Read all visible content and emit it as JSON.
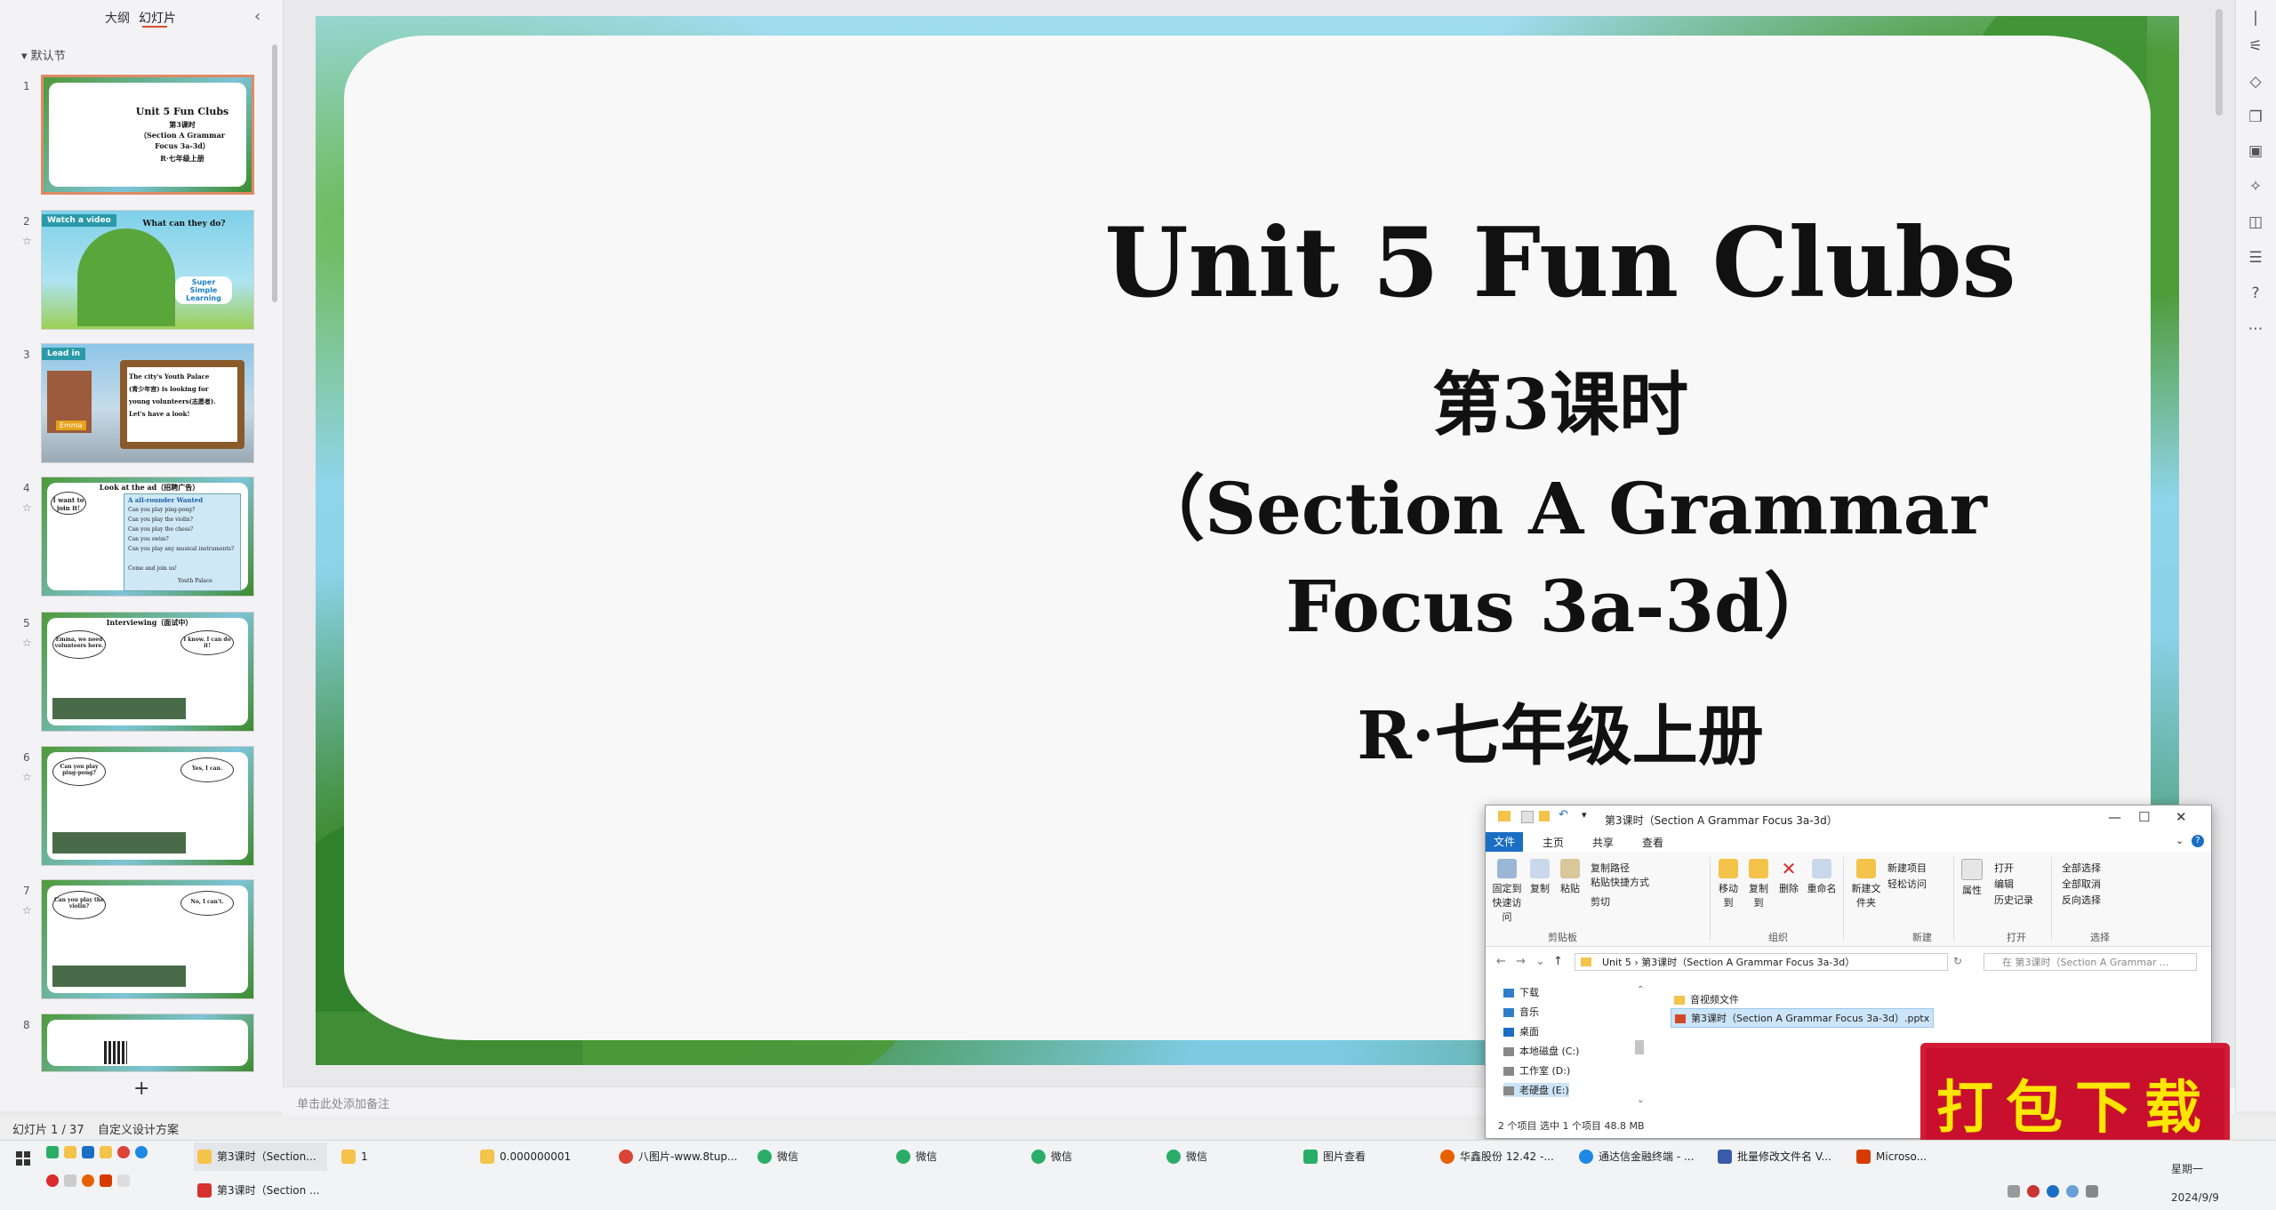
{
  "left_panel": {
    "tab_outline": "大纲",
    "tab_slides": "幻灯片",
    "collapse": "‹",
    "section_label": "▾ 默认节",
    "add_slide": "+",
    "thumbs": [
      {
        "num": "1",
        "lines": [
          "Unit 5 Fun Clubs",
          "第3课时",
          "（Section A Grammar",
          "Focus 3a-3d）",
          "R·七年级上册"
        ]
      },
      {
        "num": "2",
        "tag": "Watch a video",
        "text": "What can they do?",
        "logo": "Super Simple Learning"
      },
      {
        "num": "3",
        "tag": "Lead in",
        "lines": [
          "The city's Youth Palace",
          "(青少年宫) is looking for",
          "young volunteers(志愿者).",
          "Let's have a look!"
        ],
        "name": "Emma"
      },
      {
        "num": "4",
        "header": "Look at the ad（招聘广告）",
        "bubble": "I want to join it!",
        "ad_title": "A all-rounder Wanted",
        "ad_lines": [
          "Can you play ping-pong?",
          "Can you play the violin?",
          "Can you play the chess?",
          "Can you swim?",
          "Can you play any musical instruments?",
          "Come and join us!",
          "Youth Palace"
        ]
      },
      {
        "num": "5",
        "header": "Interviewing（面试中）",
        "bubble_left": "Emma, we need volunteers here.",
        "bubble_right": "I know. I can do it!"
      },
      {
        "num": "6",
        "bubble_left": "Can you play ping-pong?",
        "bubble_right": "Yes, I can."
      },
      {
        "num": "7",
        "bubble_left": "Can you play the violin?",
        "bubble_right": "No, I can't."
      },
      {
        "num": "8"
      }
    ]
  },
  "slide": {
    "title": "Unit 5 Fun Clubs",
    "lesson": "第3课时",
    "section_line1": "（Section A Grammar",
    "section_line2": "Focus 3a-3d）",
    "grade": "R·七年级上册"
  },
  "notes_placeholder": "单击此处添加备注",
  "status": {
    "slide_count": "幻灯片 1 / 37",
    "design_scheme": "自定义设计方案"
  },
  "explorer": {
    "title": "第3课时（Section A Grammar Focus 3a-3d）",
    "menu": [
      "文件",
      "主页",
      "共享",
      "查看"
    ],
    "ribbon": {
      "pin": "固定到快速访问",
      "copy": "复制",
      "paste": "粘贴",
      "copy_path": "复制路径",
      "paste_shortcut": "粘贴快捷方式",
      "cut": "剪切",
      "group_clipboard": "剪贴板",
      "move_to": "移动到",
      "copy_to": "复制到",
      "delete": "删除",
      "rename": "重命名",
      "group_organize": "组织",
      "new_folder": "新建文件夹",
      "new_item": "新建项目",
      "easy_access": "轻松访问",
      "group_new": "新建",
      "properties": "属性",
      "open": "打开",
      "edit": "编辑",
      "history": "历史记录",
      "group_open": "打开",
      "select_all": "全部选择",
      "select_none": "全部取消",
      "invert": "反向选择",
      "group_select": "选择"
    },
    "address": [
      "Unit 5",
      "第3课时（Section A Grammar Focus 3a-3d）"
    ],
    "search_placeholder": "在 第3课时（Section A Grammar ...",
    "nav": [
      "下载",
      "音乐",
      "桌面",
      "本地磁盘 (C:)",
      "工作室 (D:)",
      "老硬盘 (E:)"
    ],
    "files": [
      {
        "name": "音视频文件",
        "type": "folder"
      },
      {
        "name": "第3课时（Section A Grammar Focus 3a-3d）.pptx",
        "type": "pptx",
        "selected": true
      }
    ],
    "status": "2 个项目     选中 1 个项目  48.8 MB"
  },
  "download_badge": "打包下载",
  "taskbar": {
    "items": [
      {
        "label": "第3课时（Section...",
        "icon": "folder-icon",
        "color": "#f3c34a"
      },
      {
        "label": "1",
        "icon": "folder-icon",
        "color": "#f3c34a"
      },
      {
        "label": "0.000000001",
        "icon": "folder-icon",
        "color": "#f3c34a"
      },
      {
        "label": "八图片-www.8tup...",
        "icon": "chrome-icon",
        "color": "#db4437"
      },
      {
        "label": "微信",
        "icon": "wechat-icon",
        "color": "#2aae67"
      },
      {
        "label": "微信",
        "icon": "wechat-icon",
        "color": "#2aae67"
      },
      {
        "label": "微信",
        "icon": "wechat-icon",
        "color": "#2aae67"
      },
      {
        "label": "微信",
        "icon": "wechat-icon",
        "color": "#2aae67"
      },
      {
        "label": "图片查看",
        "icon": "image-viewer-icon",
        "color": "#2aae67"
      },
      {
        "label": "华鑫股份 12.42 -...",
        "icon": "firefox-icon",
        "color": "#e66000"
      },
      {
        "label": "通达信金融终端 - ...",
        "icon": "edge-icon",
        "color": "#1e88e5"
      },
      {
        "label": "批量修改文件名 V...",
        "icon": "app-icon",
        "color": "#3a5ba9"
      },
      {
        "label": "Microso...",
        "icon": "office-icon",
        "color": "#d83b01"
      }
    ],
    "second_row": {
      "label": "第3课时（Section ...",
      "icon": "wps-icon",
      "color": "#d8302f"
    },
    "time": "星期一",
    "date": "2024/9/9"
  }
}
